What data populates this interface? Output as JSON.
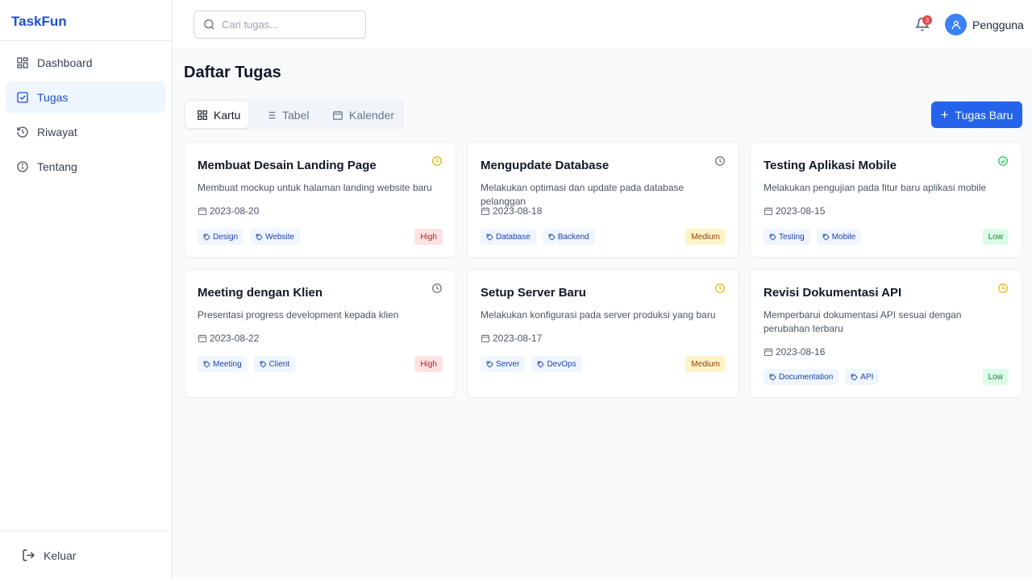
{
  "app": {
    "name": "TaskFun"
  },
  "sidebar": {
    "items": [
      {
        "label": "Dashboard",
        "icon": "dashboard-icon"
      },
      {
        "label": "Tugas",
        "icon": "checkbox-icon",
        "active": true
      },
      {
        "label": "Riwayat",
        "icon": "history-icon"
      },
      {
        "label": "Tentang",
        "icon": "info-icon"
      }
    ],
    "logout_label": "Keluar"
  },
  "topbar": {
    "search_placeholder": "Cari tugas...",
    "notification_count": "3",
    "user_name": "Pengguna"
  },
  "main": {
    "title": "Daftar Tugas",
    "view_tabs": [
      {
        "label": "Kartu",
        "icon": "grid-icon",
        "active": true
      },
      {
        "label": "Tabel",
        "icon": "list-icon"
      },
      {
        "label": "Kalender",
        "icon": "calendar-icon"
      }
    ],
    "new_task_label": "Tugas Baru"
  },
  "tasks": [
    {
      "title": "Membuat Desain Landing Page",
      "description": "Membuat mockup untuk halaman landing website baru",
      "date": "2023-08-20",
      "tags": [
        "Design",
        "Website"
      ],
      "priority": "High",
      "status": "in-progress"
    },
    {
      "title": "Mengupdate Database",
      "description": "Melakukan optimasi dan update pada database pelanggan",
      "date": "2023-08-18",
      "tags": [
        "Database",
        "Backend"
      ],
      "priority": "Medium",
      "status": "pending"
    },
    {
      "title": "Testing Aplikasi Mobile",
      "description": "Melakukan pengujian pada fitur baru aplikasi mobile",
      "date": "2023-08-15",
      "tags": [
        "Testing",
        "Mobile"
      ],
      "priority": "Low",
      "status": "completed"
    },
    {
      "title": "Meeting dengan Klien",
      "description": "Presentasi progress development kepada klien",
      "date": "2023-08-22",
      "tags": [
        "Meeting",
        "Client"
      ],
      "priority": "High",
      "status": "pending"
    },
    {
      "title": "Setup Server Baru",
      "description": "Melakukan konfigurasi pada server produksi yang baru",
      "date": "2023-08-17",
      "tags": [
        "Server",
        "DevOps"
      ],
      "priority": "Medium",
      "status": "in-progress"
    },
    {
      "title": "Revisi Dokumentasi API",
      "description": "Memperbarui dokumentasi API sesuai dengan perubahan terbaru",
      "date": "2023-08-16",
      "tags": [
        "Documentation",
        "API"
      ],
      "priority": "Low",
      "status": "in-progress"
    }
  ],
  "colors": {
    "accent": "#2563eb",
    "status_in_progress": "#eab308",
    "status_pending": "#6b7280",
    "status_completed": "#22c55e"
  }
}
